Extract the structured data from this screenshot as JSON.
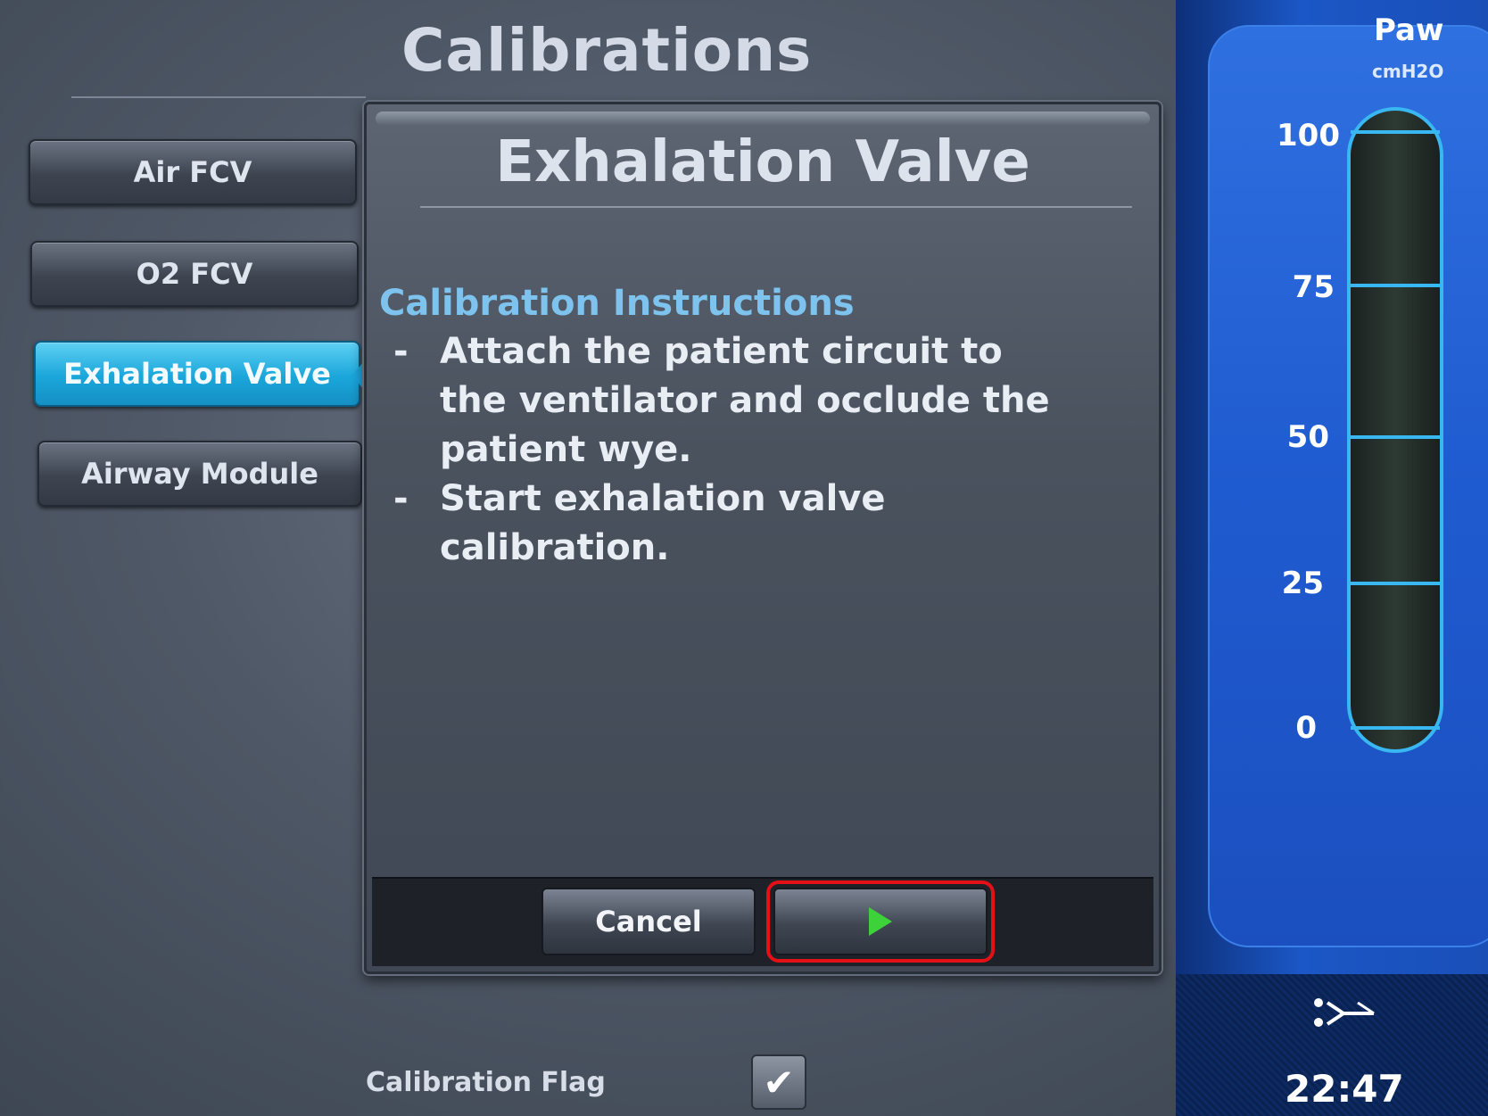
{
  "screen": {
    "title": "Calibrations"
  },
  "nav": {
    "items": [
      {
        "label": "Air FCV",
        "active": false
      },
      {
        "label": "O2 FCV",
        "active": false
      },
      {
        "label": "Exhalation Valve",
        "active": true
      },
      {
        "label": "Airway Module",
        "active": false
      }
    ]
  },
  "dialog": {
    "title": "Exhalation Valve",
    "instructions_heading": "Calibration Instructions",
    "instructions": [
      "Attach the patient circuit to the ventilator and occlude the patient wye.",
      "Start exhalation valve calibration."
    ],
    "bullet": "-",
    "cancel_label": "Cancel",
    "start_icon": "play-icon"
  },
  "calibration_flag": {
    "label": "Calibration Flag",
    "checked": true,
    "check_glyph": "✔"
  },
  "gauge": {
    "title": "Paw",
    "unit": "cmH2O",
    "ticks": [
      "100",
      "75",
      "50",
      "25",
      "0"
    ]
  },
  "status": {
    "time": "22:47",
    "circuit_icon": "patient-circuit-icon"
  },
  "colors": {
    "active_tab": "#1aa6da",
    "start_highlight": "#e31016",
    "play": "#3ed23a",
    "gauge_accent": "#38b7f0"
  }
}
